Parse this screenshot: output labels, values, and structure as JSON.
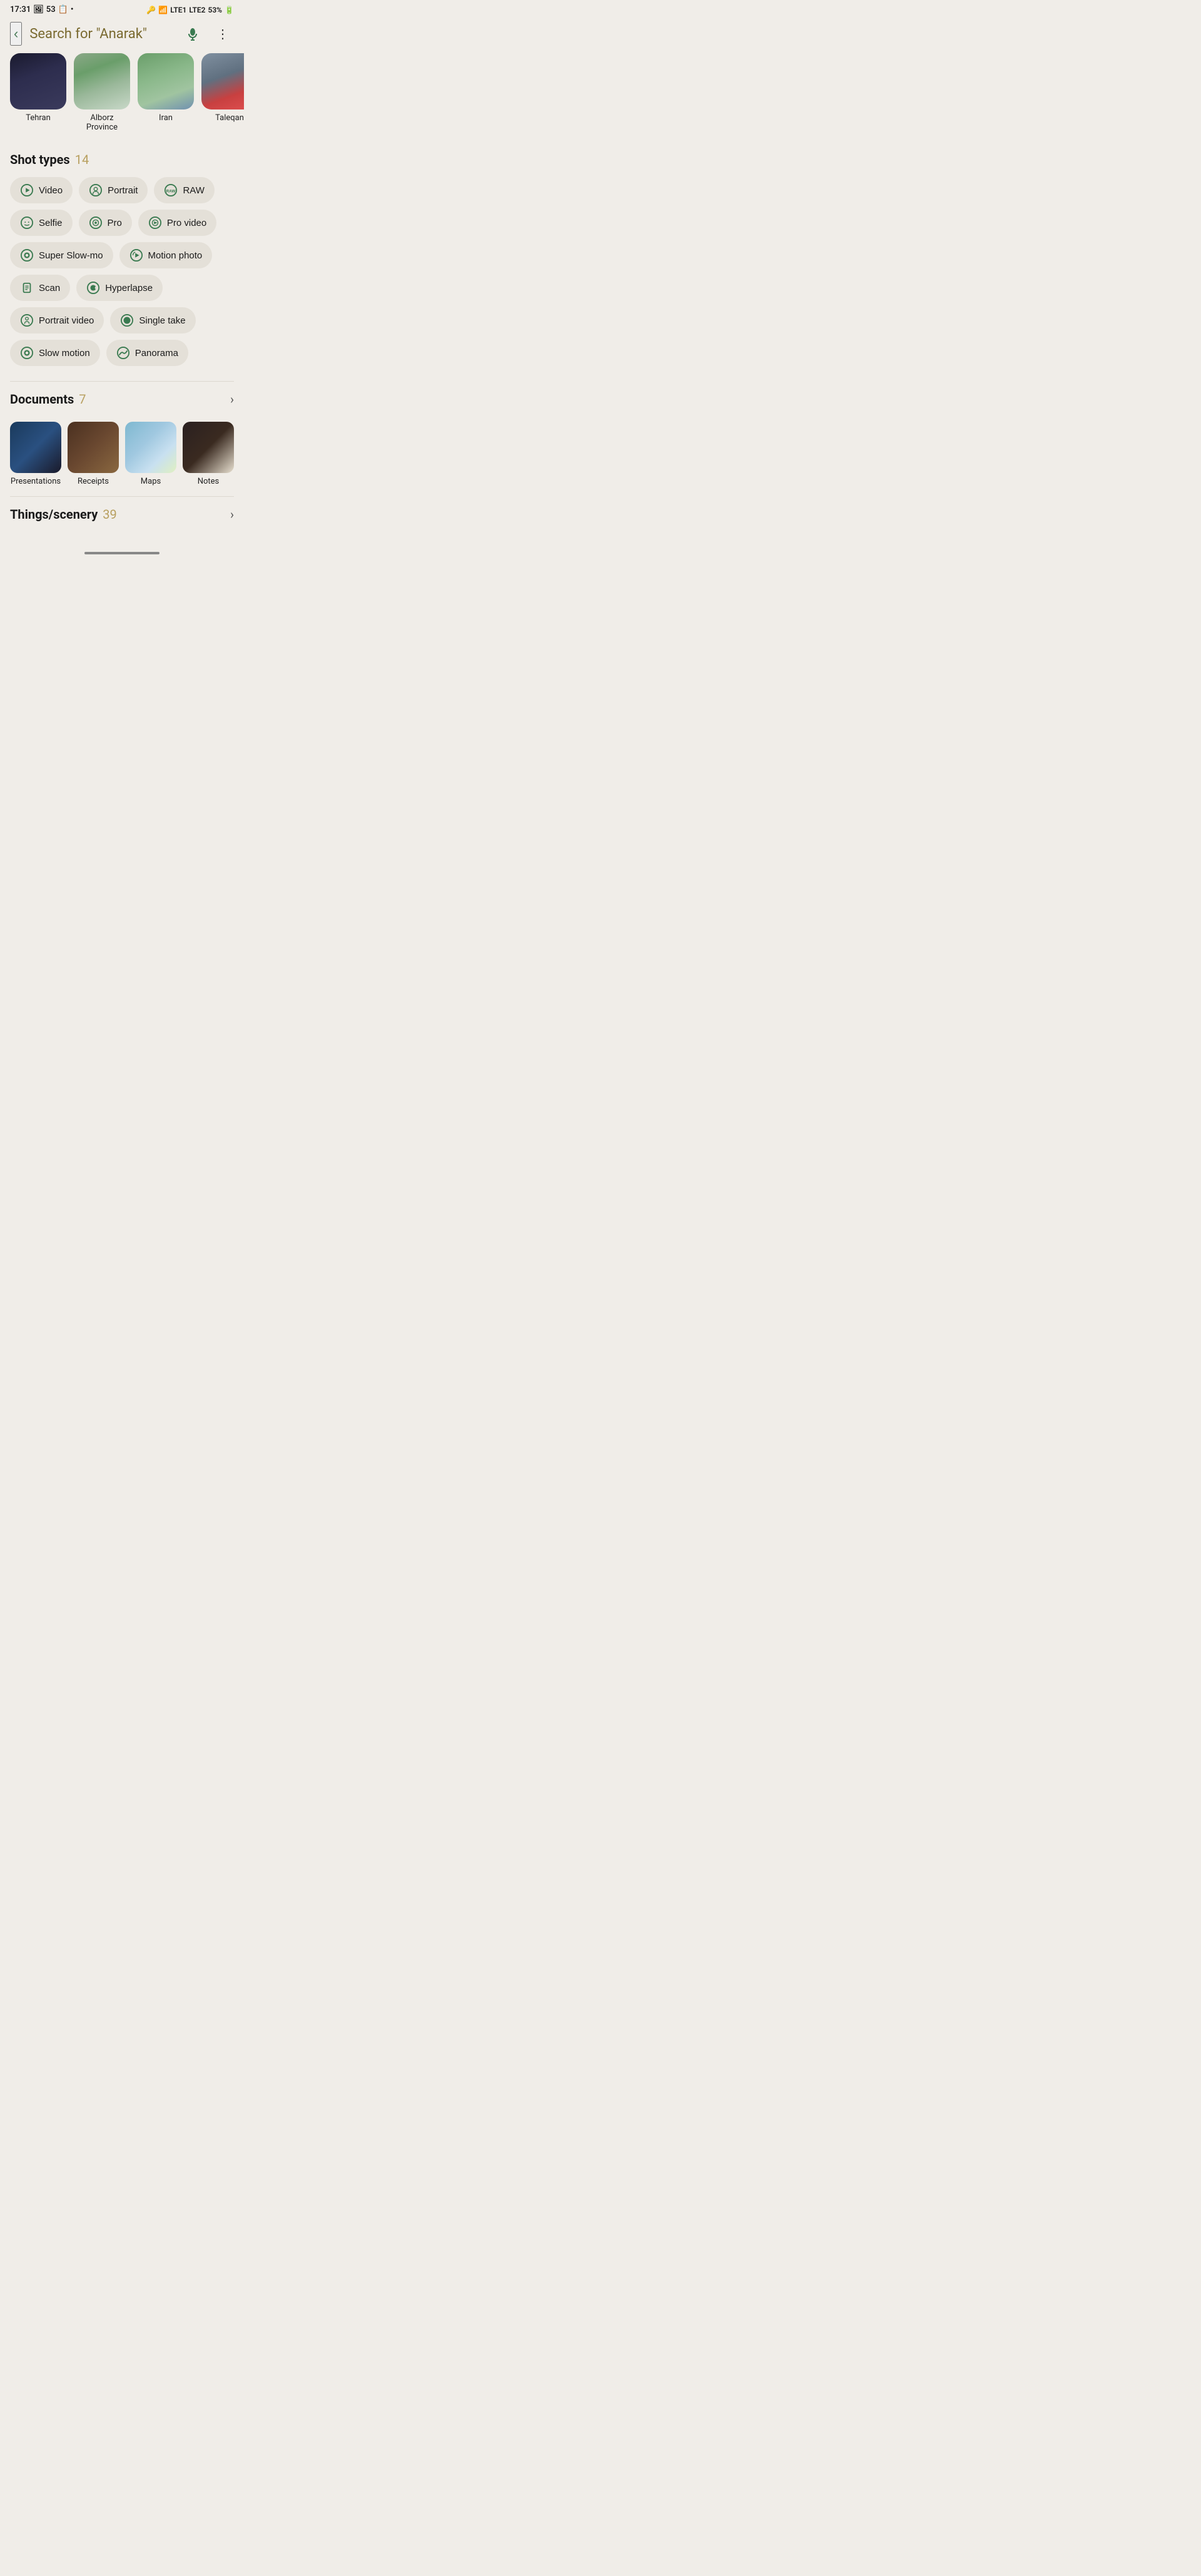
{
  "statusBar": {
    "time": "17:31",
    "battery": "53%",
    "batteryIcon": "battery-icon"
  },
  "header": {
    "searchQuery": "Search for \"Anarak\"",
    "backLabel": "‹",
    "micIcon": "mic-icon",
    "moreIcon": "more-icon"
  },
  "locations": [
    {
      "id": "tehran",
      "label": "Tehran",
      "thumbClass": "thumb-tehran"
    },
    {
      "id": "alborz",
      "label": "Alborz Province",
      "thumbClass": "thumb-alborz"
    },
    {
      "id": "iran",
      "label": "Iran",
      "thumbClass": "thumb-iran"
    },
    {
      "id": "taleqan",
      "label": "Taleqan",
      "thumbClass": "thumb-taleqan"
    }
  ],
  "shotTypes": {
    "sectionLabel": "Shot types",
    "count": "14",
    "chips": [
      {
        "id": "video",
        "label": "Video",
        "icon": "play-icon"
      },
      {
        "id": "portrait",
        "label": "Portrait",
        "icon": "portrait-icon"
      },
      {
        "id": "raw",
        "label": "RAW",
        "icon": "raw-icon"
      },
      {
        "id": "selfie",
        "label": "Selfie",
        "icon": "selfie-icon"
      },
      {
        "id": "pro",
        "label": "Pro",
        "icon": "pro-icon"
      },
      {
        "id": "pro-video",
        "label": "Pro video",
        "icon": "pro-video-icon"
      },
      {
        "id": "super-slowmo",
        "label": "Super Slow-mo",
        "icon": "super-slowmo-icon"
      },
      {
        "id": "motion-photo",
        "label": "Motion photo",
        "icon": "motion-photo-icon"
      },
      {
        "id": "scan",
        "label": "Scan",
        "icon": "scan-icon"
      },
      {
        "id": "hyperlapse",
        "label": "Hyperlapse",
        "icon": "hyperlapse-icon"
      },
      {
        "id": "portrait-video",
        "label": "Portrait video",
        "icon": "portrait-video-icon"
      },
      {
        "id": "single-take",
        "label": "Single take",
        "icon": "single-take-icon"
      },
      {
        "id": "slow-motion",
        "label": "Slow motion",
        "icon": "slow-motion-icon"
      },
      {
        "id": "panorama",
        "label": "Panorama",
        "icon": "panorama-icon"
      }
    ]
  },
  "documents": {
    "sectionLabel": "Documents",
    "count": "7",
    "items": [
      {
        "id": "presentations",
        "label": "Presentations",
        "thumbClass": "thumb-presentations"
      },
      {
        "id": "receipts",
        "label": "Receipts",
        "thumbClass": "thumb-receipts"
      },
      {
        "id": "maps",
        "label": "Maps",
        "thumbClass": "thumb-maps"
      },
      {
        "id": "notes",
        "label": "Notes",
        "thumbClass": "thumb-notes"
      }
    ]
  },
  "thingsScenery": {
    "sectionLabel": "Things/scenery",
    "count": "39"
  }
}
